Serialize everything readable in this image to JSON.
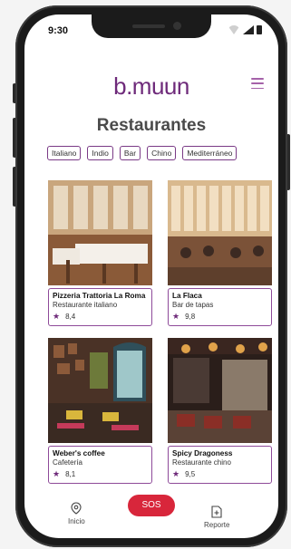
{
  "status_bar": {
    "time": "9:30"
  },
  "brand": {
    "logo": "b.muun"
  },
  "page": {
    "title": "Restaurantes"
  },
  "filters": [
    "Italiano",
    "Indio",
    "Bar",
    "Chino",
    "Mediterráneo"
  ],
  "restaurants": [
    {
      "name": "Pizzeria Trattoria La Roma",
      "type": "Restaurante italiano",
      "rating": "8,4"
    },
    {
      "name": "La Flaca",
      "type": "Bar de tapas",
      "rating": "9,8"
    },
    {
      "name": "Weber's coffee",
      "type": "Cafetería",
      "rating": "8,1"
    },
    {
      "name": "Spicy Dragoness",
      "type": "Restaurante chino",
      "rating": "9,5"
    }
  ],
  "nav": {
    "home_label": "Inicio",
    "sos_label": "SOS",
    "report_label": "Reporte"
  },
  "colors": {
    "accent": "#6e2a7a",
    "sos": "#d8263b",
    "border": "#8e4a99"
  }
}
